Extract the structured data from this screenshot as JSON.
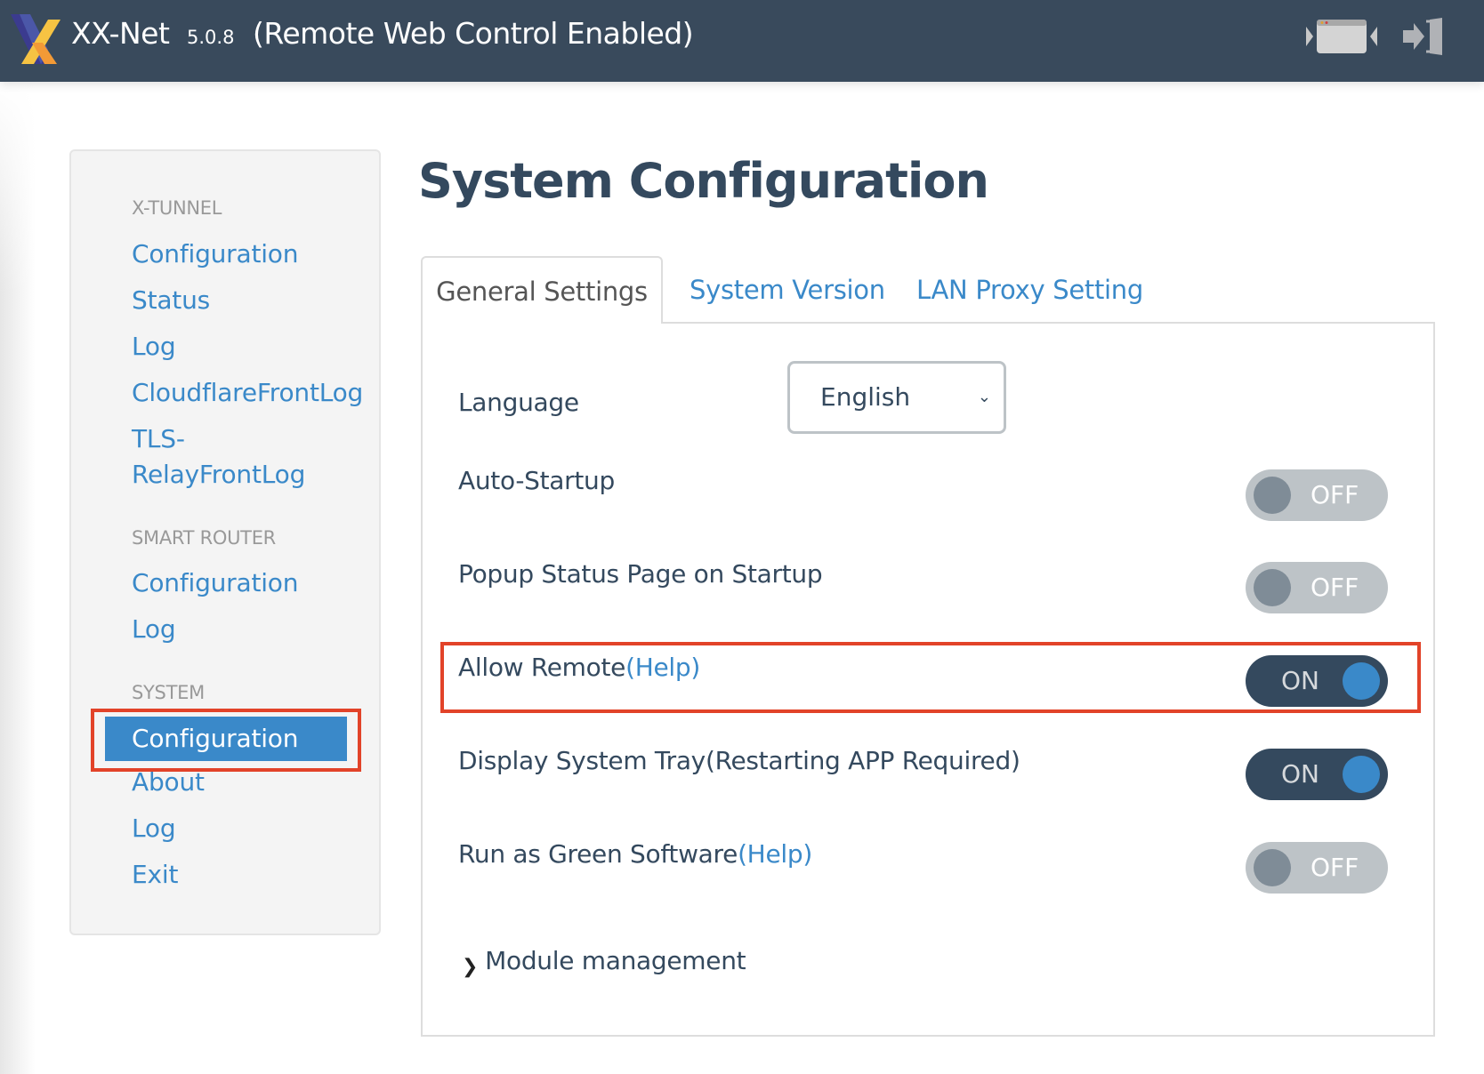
{
  "header": {
    "app_name": "XX-Net",
    "version": "5.0.8",
    "status": "(Remote Web Control Enabled)",
    "icons": [
      "xx-net-logo",
      "window-icon",
      "logout-icon"
    ]
  },
  "sidebar": {
    "sections": [
      {
        "heading": "X-TUNNEL",
        "items": [
          "Configuration",
          "Status",
          "Log",
          "CloudflareFrontLog",
          "TLS-\nRelayFrontLog"
        ]
      },
      {
        "heading": "SMART ROUTER",
        "items": [
          "Configuration",
          "Log"
        ]
      },
      {
        "heading": "SYSTEM",
        "items": [
          "Configuration",
          "About",
          "Log",
          "Exit"
        ],
        "active": "Configuration"
      }
    ]
  },
  "page": {
    "title": "System Configuration",
    "tabs": [
      {
        "label": "General Settings",
        "active": true
      },
      {
        "label": "System Version",
        "active": false
      },
      {
        "label": "LAN Proxy Setting",
        "active": false
      }
    ]
  },
  "settings": {
    "language": {
      "label": "Language",
      "value": "English"
    },
    "rows": [
      {
        "label": "Auto-Startup",
        "help": null,
        "state": "OFF"
      },
      {
        "label": "Popup Status Page on Startup",
        "help": null,
        "state": "OFF"
      },
      {
        "label": "Allow Remote",
        "help": "(Help)",
        "state": "ON",
        "highlighted": true
      },
      {
        "label": "Display System Tray(Restarting APP Required)",
        "help": null,
        "state": "ON"
      },
      {
        "label": "Run as Green Software",
        "help": "(Help)",
        "state": "OFF"
      }
    ],
    "module_management": "Module management"
  },
  "colors": {
    "header_bg": "#394a5c",
    "link": "#3a89c9",
    "toggle_on": "#34495e",
    "toggle_off": "#bdc3c7",
    "highlight": "#e24329"
  }
}
